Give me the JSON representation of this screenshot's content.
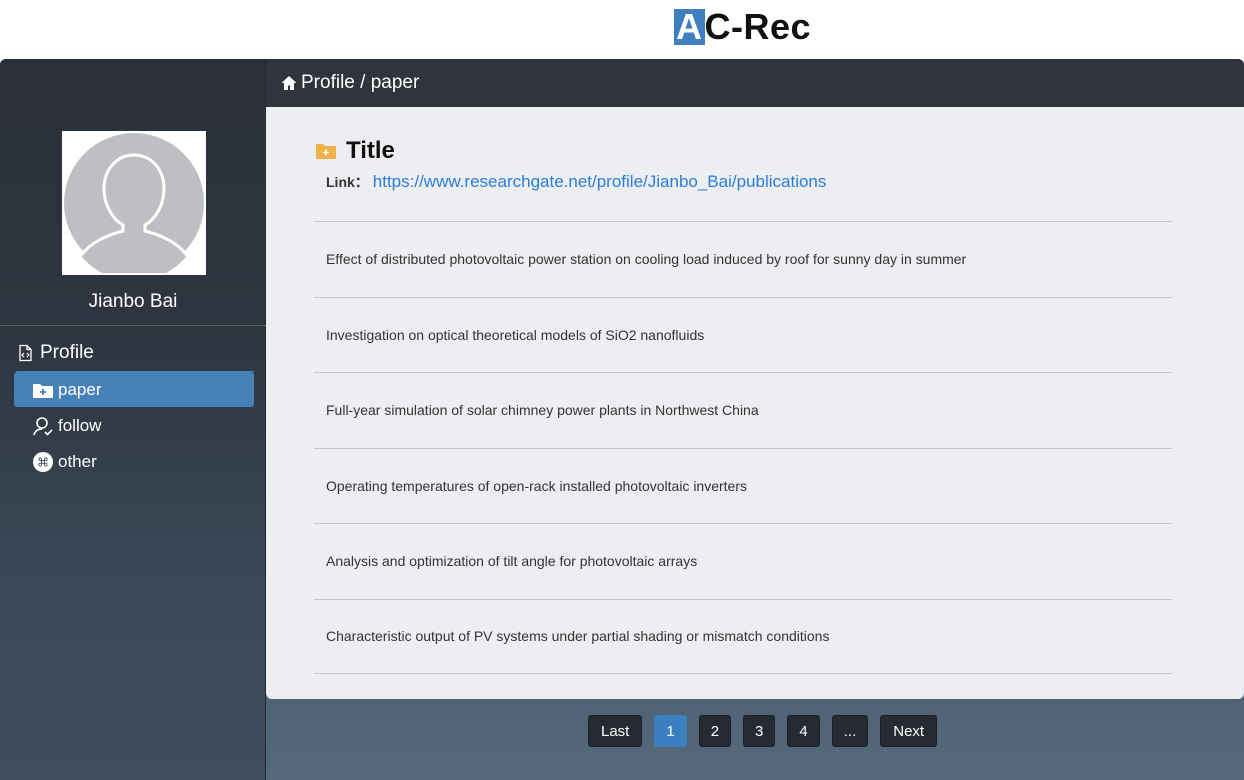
{
  "brand": {
    "first_letter": "A",
    "rest": "C-Rec"
  },
  "breadcrumb": "Profile / paper",
  "user": {
    "name": "Jianbo Bai"
  },
  "sidebar": {
    "heading": "Profile",
    "items": [
      {
        "label": "paper",
        "icon": "folder-plus-icon",
        "active": true
      },
      {
        "label": "follow",
        "icon": "user-check-icon",
        "active": false
      },
      {
        "label": "other",
        "icon": "command-icon",
        "active": false
      }
    ]
  },
  "main": {
    "title": "Title",
    "link_label": "Link：",
    "link_url": "https://www.researchgate.net/profile/Jianbo_Bai/publications",
    "papers": [
      "Effect of distributed photovoltaic power station on cooling load induced by roof for sunny day in summer",
      "Investigation on optical theoretical models of SiO2 nanofluids",
      "Full-year simulation of solar chimney power plants in Northwest China",
      "Operating temperatures of open-rack installed photovoltaic inverters",
      "Analysis and optimization of tilt angle for photovoltaic arrays",
      "Characteristic output of PV systems under partial shading or mismatch conditions"
    ]
  },
  "pagination": {
    "prev": "Last",
    "pages": [
      "1",
      "2",
      "3",
      "4",
      "..."
    ],
    "current": "1",
    "next": "Next"
  },
  "colors": {
    "accent": "#4682b8",
    "link": "#2b7ed8",
    "folder": "#f0b04a"
  }
}
